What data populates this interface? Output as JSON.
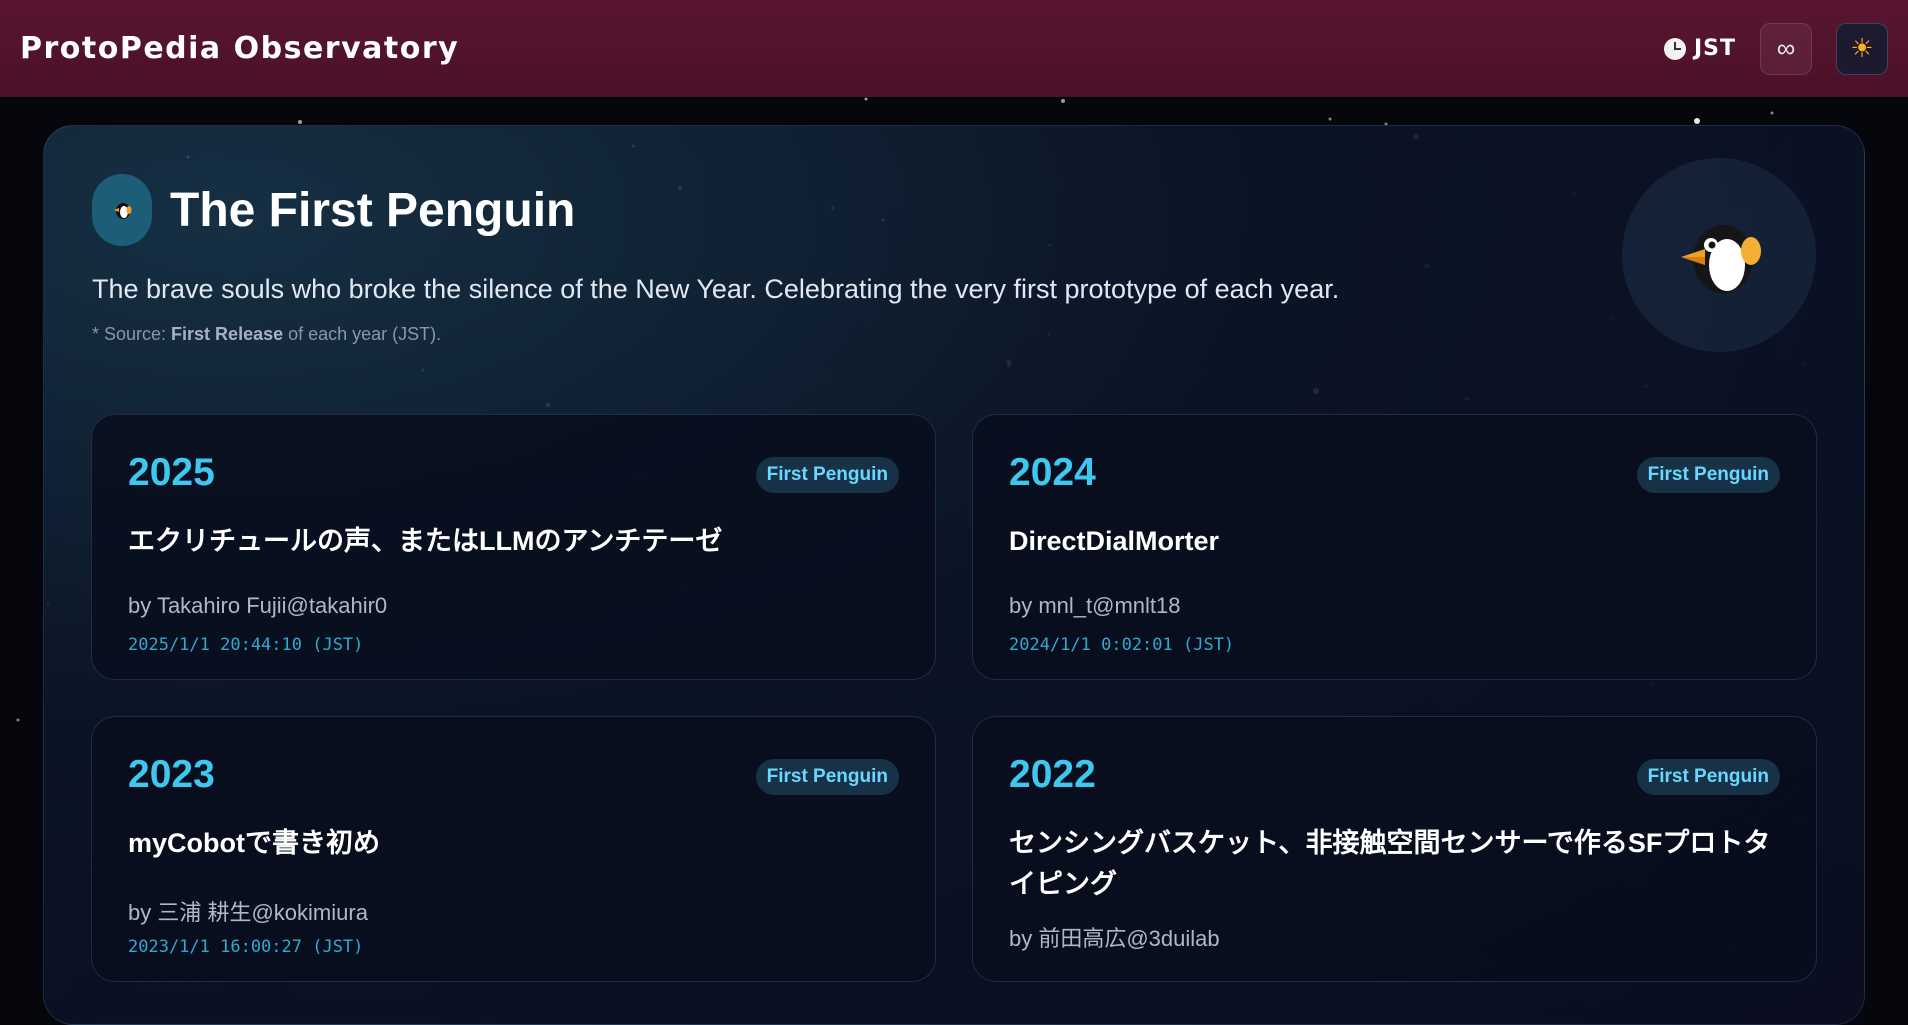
{
  "header": {
    "brand": "ProtoPedia Observatory",
    "timezone_label": "JST",
    "infinity_icon": "infinity-icon",
    "theme_icon": "sun-icon"
  },
  "section": {
    "title": "The First Penguin",
    "description": "The brave souls who broke the silence of the New Year. Celebrating the very first prototype of each year.",
    "source_prefix": "* Source: ",
    "source_bold": "First Release",
    "source_suffix": " of each year (JST).",
    "icon": "penguin-icon"
  },
  "cards": [
    {
      "year": "2025",
      "badge": "First Penguin",
      "title": "エクリチュールの声、またはLLMのアンチテーゼ",
      "by": "by Takahiro Fujii@takahir0",
      "time": "2025/1/1 20:44:10 (JST)"
    },
    {
      "year": "2024",
      "badge": "First Penguin",
      "title": "DirectDialMorter",
      "by": "by mnl_t@mnlt18",
      "time": "2024/1/1 0:02:01 (JST)"
    },
    {
      "year": "2023",
      "badge": "First Penguin",
      "title": "myCobotで書き初め",
      "by": "by 三浦 耕生@kokimiura",
      "time": "2023/1/1 16:00:27 (JST)"
    },
    {
      "year": "2022",
      "badge": "First Penguin",
      "title": "センシングバスケット、非接触空間センサーで作るSFプロトタイピング",
      "by": "by 前田高広@3duilab",
      "time": ""
    }
  ],
  "colors": {
    "header_bg": "#4a1128",
    "accent_year": "#3ec8f0",
    "badge_bg": "#173247",
    "badge_text": "#69d8ff",
    "timestamp": "#2fa9d0"
  }
}
